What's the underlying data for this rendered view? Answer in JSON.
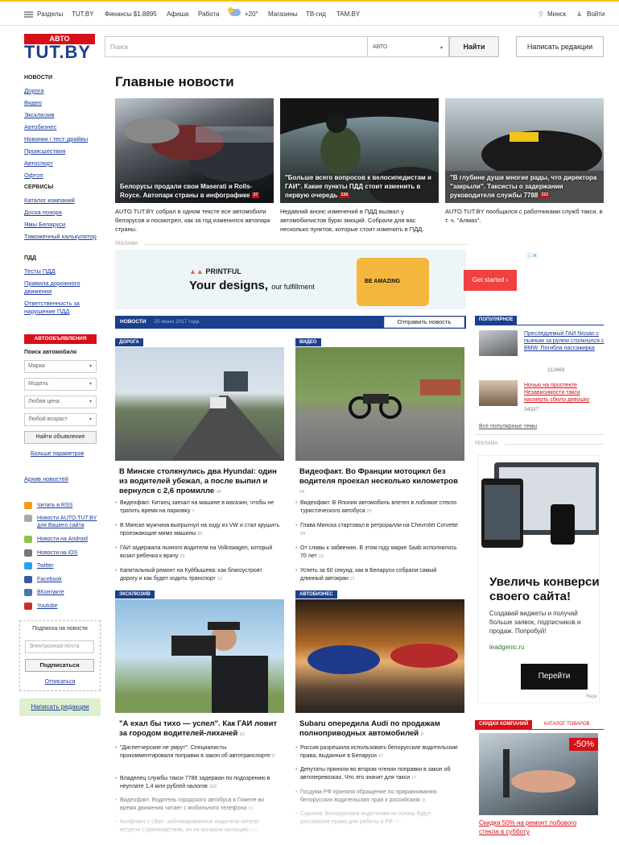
{
  "topbar": {
    "sections": "Разделы",
    "tutby": "TUT.BY",
    "finance": "Финансы $1.8895",
    "afisha": "Афиша",
    "work": "Работа",
    "weather": "+20°",
    "shops": "Магазины",
    "tv": "ТВ-гид",
    "tam": "TAM.BY",
    "city": "Минск",
    "login": "Войти"
  },
  "header": {
    "logo_top": "АВТО",
    "logo_main": "TUT.BY",
    "search_placeholder": "Поиск",
    "search_scope": "АВТО",
    "find_btn": "Найти",
    "write_btn": "Написать редакции"
  },
  "sidebar": {
    "news_heading": "НОВОСТИ",
    "news_links": [
      "Дорога",
      "Видео",
      "Эксклюзив",
      "Автобизнес",
      "Новинки / тест-драйвы",
      "Происшествия",
      "Автоспорт",
      "Офтоп"
    ],
    "services_heading": "СЕРВИСЫ",
    "services_links": [
      "Каталог компаний",
      "Доска позора",
      "Ямы Беларуси",
      "Таможенный калькулятор"
    ],
    "pdd_heading": "ПДД",
    "pdd_links": [
      "Тесты ПДД",
      "Правила дорожного движения",
      "Ответственность за нарушение ПДД"
    ],
    "ads_heading": "АВТООБЪЯВЛЕНИЯ",
    "search_auto": "Поиск автомобиля",
    "selects": [
      "Марка",
      "Модель",
      "Любая цена",
      "Любой возраст"
    ],
    "find_ad_btn": "Найти объявление",
    "more_params": "Больше параметров",
    "archive": "Архив новостей",
    "social": [
      "Читать в RSS",
      "Новости AUTO.TUT.BY для Вашего сайта",
      "Новости на Android",
      "Новости на iOS",
      "Twitter",
      "Facebook",
      "ВКонтакте",
      "Youtube"
    ],
    "subscribe_title": "Подписка на новости",
    "email_placeholder": "Электронная почта",
    "subscribe_btn": "Подписаться",
    "unsubscribe": "Отписаться",
    "write_editors": "Написать редакции"
  },
  "main": {
    "title": "Главные новости",
    "top_stories": [
      {
        "caption": "Белорусы продали свои Maserati и Rolls-Royce. Автопарк страны в инфографике",
        "count": "37",
        "lead": "AUTO.TUT.BY собрал в одном тексте все автомобили белорусов и посмотрел, как за год изменился автопарк страны."
      },
      {
        "caption": "\"Больше всего вопросов к велосипедистам и ГАИ\". Какие пункты ПДД стоит изменить в первую очередь",
        "count": "228",
        "lead": "Недавний анонс изменений в ПДД вызвал у автомобилистов бурю эмоций. Собрали для вас несколько пунктов, которые стоит изменить в ПДД."
      },
      {
        "caption": "\"В глубине души многие рады, что директора \"закрыли\". Таксисты о задержании руководителя службы 7788",
        "count": "223",
        "lead": "AUTO.TUT.BY пообщался с работниками служб такси, в т. ч. \"Алмаз\"."
      }
    ],
    "ad_label": "РЕКЛАМА",
    "ad_brand": "PRINTFUL",
    "ad_text_big": "Your designs,",
    "ad_text_small": "our fulfillment",
    "ad_mug": "BE AMAZING",
    "ad_btn": "Get started ›",
    "news_bar_title": "НОВОСТИ",
    "news_bar_date": "20 июня 2017 года",
    "send_news_btn": "Отправить новость",
    "sections": [
      {
        "tag": "ДОРОГА",
        "title": "В Минске столкнулись два Hyundai: один из водителей убежал, а после выпил и вернулся с 2,6 промилле",
        "count": "46",
        "items": [
          {
            "text": "Видеофакт. Китаец заехал на машине в магазин, чтобы не тратить время на парковку",
            "count": "7"
          },
          {
            "text": "В Минске мужчина выпрыгнул на ходу из VW и стал крушить проезжающие мимо машины",
            "count": "86"
          },
          {
            "text": "ГАИ задержала пьяного водителя на Volkswagen, который возил ребенка к врачу",
            "count": "25"
          },
          {
            "text": "Капитальный ремонт на Куйбышева: как благоустроят дорогу и как будет ходить транспорт",
            "count": "12"
          }
        ]
      },
      {
        "tag": "ВИДЕО",
        "title": "Видеофакт. Во Франции мотоцикл без водителя проехал несколько километров",
        "count": "24",
        "items": [
          {
            "text": "Видеофакт. В Японии автомобиль влетел в лобовое стекло туристического автобуса",
            "count": "20"
          },
          {
            "text": "Глава Минска стартовал в ретроралли на Chevrolet Corvette",
            "count": "24"
          },
          {
            "text": "От славы к забвению. В этом году марке Saab исполнилось 70 лет",
            "count": "33"
          },
          {
            "text": "Успеть за 60 секунд: как в Беларуси собрали самый длинный автокран",
            "count": "27"
          }
        ]
      },
      {
        "tag": "ЭКСКЛЮЗИВ",
        "title": "\"А ехал бы тихо — успел\". Как ГАИ ловит за городом водителей-лихачей",
        "count": "62",
        "items": [
          {
            "text": "\"Диспетчерские не умрут\". Специалисты прокомментировали поправки в закон об автотранспорте",
            "count": "6"
          },
          {
            "text": "Владелец службы такси 7788 задержан по подозрению в неуплате 1,4 млн рублей налогов",
            "count": "323"
          },
          {
            "text": "Видеофакт. Водитель городского автобуса в Гомеле во время движения читает с мобильного телефона",
            "count": "30"
          },
          {
            "text": "Конфликт с Uber: заблокированные водители хотели встречи с руководством, но их вызвали милицию",
            "count": "102"
          }
        ]
      },
      {
        "tag": "АВТОБИЗНЕС",
        "title": "Subaru опередила Audi по продажам полноприводных автомобилей",
        "count": "8",
        "items": [
          {
            "text": "Россия разрешила использовать белорусские водительские права, выданные в Беларуси",
            "count": "47"
          },
          {
            "text": "Депутаты приняли во втором чтении поправки в закон об автоперевозках. Что это значит для такси",
            "count": "17"
          },
          {
            "text": "Госдума РФ приняла обращение по приравниванию белорусских водительских прав к российским",
            "count": "35"
          },
          {
            "text": "Суриков: Белорусским водителям не нужны будут российские права для работы в РФ",
            "count": "57"
          }
        ]
      }
    ]
  },
  "right": {
    "popular_tag": "ПОПУЛЯРНОЕ",
    "popular": [
      {
        "text": "Преследуемый ГАИ Nissan с пьяным за рулем столкнулся с BMW. Погибла пассажирка",
        "count": "112669"
      },
      {
        "text": "Ночью на проспекте Независимости такси насмерть сбило девушку",
        "count": "34337"
      }
    ],
    "all_popular": "Все популярные темы",
    "ad_label": "РЕКЛАМА",
    "ad_title": "Увеличь конверсию своего сайта!",
    "ad_text": "Создавай виджеты и получай больше заявок, подписчиков и продаж. Попробуй!",
    "ad_link": "leadgenic.ru",
    "ad_btn": "Перейти",
    "ad_foot": "Янде",
    "discounts_tag": "СКИДКИ КОМПАНИЙ",
    "catalog_tag": "КАТАЛОГ ТОВАРОВ",
    "discount_pct": "-50%",
    "discount_text": "Скидка 50% на ремонт лобового стекла в субботу"
  }
}
